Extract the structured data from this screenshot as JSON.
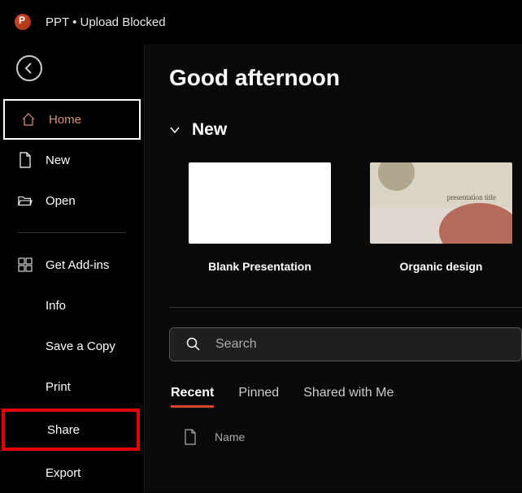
{
  "titlebar": {
    "text": "PPT • Upload Blocked"
  },
  "sidebar": {
    "items": [
      {
        "label": "Home"
      },
      {
        "label": "New"
      },
      {
        "label": "Open"
      },
      {
        "label": "Get Add-ins"
      },
      {
        "label": "Info"
      },
      {
        "label": "Save a Copy"
      },
      {
        "label": "Print"
      },
      {
        "label": "Share"
      },
      {
        "label": "Export"
      }
    ]
  },
  "main": {
    "greeting": "Good afternoon",
    "new_section": {
      "title": "New",
      "templates": [
        {
          "name": "Blank Presentation"
        },
        {
          "name": "Organic design",
          "subtitle": "presentation title"
        }
      ]
    },
    "search": {
      "placeholder": "Search"
    },
    "tabs": [
      {
        "label": "Recent"
      },
      {
        "label": "Pinned"
      },
      {
        "label": "Shared with Me"
      }
    ],
    "table": {
      "name_col": "Name"
    }
  }
}
